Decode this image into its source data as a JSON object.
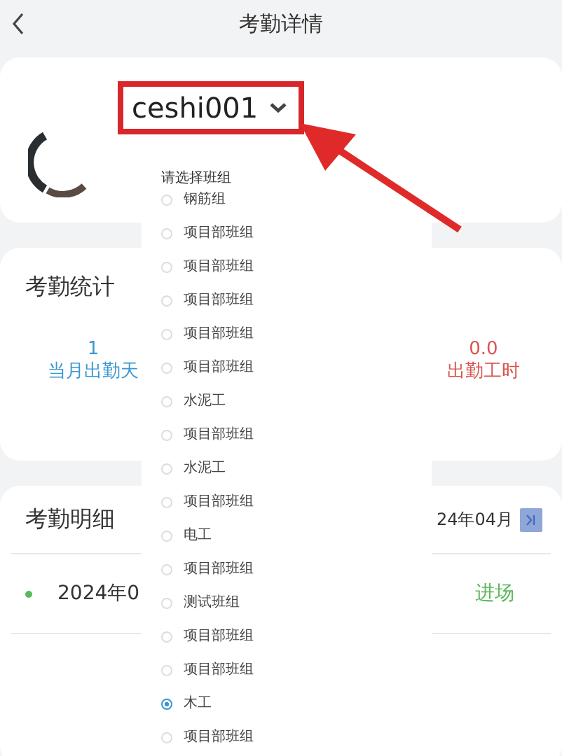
{
  "header": {
    "title": "考勤详情"
  },
  "profile": {
    "name": "ceshi001"
  },
  "stats": {
    "title": "考勤统计",
    "items": [
      {
        "kind": "days",
        "value": "1",
        "label": "当月出勤天"
      },
      {
        "kind": "hours",
        "value": "0.0",
        "label": "出勤工时"
      }
    ]
  },
  "details": {
    "title": "考勤明细",
    "month": "24年04月",
    "rows": [
      {
        "date": "2024年0",
        "status": "进场"
      }
    ]
  },
  "dropdown": {
    "title": "请选择班组",
    "options": [
      {
        "label": "钢筋组",
        "selected": false
      },
      {
        "label": "项目部班组",
        "selected": false
      },
      {
        "label": "项目部班组",
        "selected": false
      },
      {
        "label": "项目部班组",
        "selected": false
      },
      {
        "label": "项目部班组",
        "selected": false
      },
      {
        "label": "项目部班组",
        "selected": false
      },
      {
        "label": "水泥工",
        "selected": false
      },
      {
        "label": "项目部班组",
        "selected": false
      },
      {
        "label": "水泥工",
        "selected": false
      },
      {
        "label": "项目部班组",
        "selected": false
      },
      {
        "label": "电工",
        "selected": false
      },
      {
        "label": "项目部班组",
        "selected": false
      },
      {
        "label": "测试班组",
        "selected": false
      },
      {
        "label": "项目部班组",
        "selected": false
      },
      {
        "label": "项目部班组",
        "selected": false
      },
      {
        "label": "木工",
        "selected": true
      },
      {
        "label": "项目部班组",
        "selected": false
      }
    ]
  }
}
